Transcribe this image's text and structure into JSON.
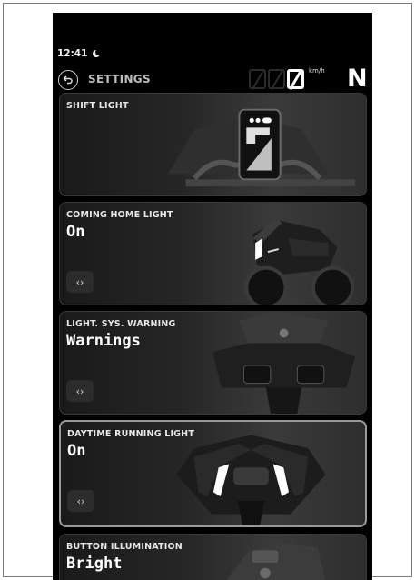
{
  "status": {
    "time": "12:41"
  },
  "header": {
    "title": "SETTINGS",
    "speed_unit": "km/h",
    "gear": "N"
  },
  "settings": [
    {
      "label": "SHIFT LIGHT",
      "value": ""
    },
    {
      "label": "COMING HOME LIGHT",
      "value": "On"
    },
    {
      "label": "LIGHT. SYS. WARNING",
      "value": "Warnings"
    },
    {
      "label": "DAYTIME RUNNING LIGHT",
      "value": "On"
    },
    {
      "label": "BUTTON ILLUMINATION",
      "value": "Bright"
    }
  ],
  "toggle_glyph": "‹›",
  "colors": {
    "screen_bg": "#000000",
    "card_border_selected": "#9a9a9a",
    "text": "#ffffff"
  }
}
